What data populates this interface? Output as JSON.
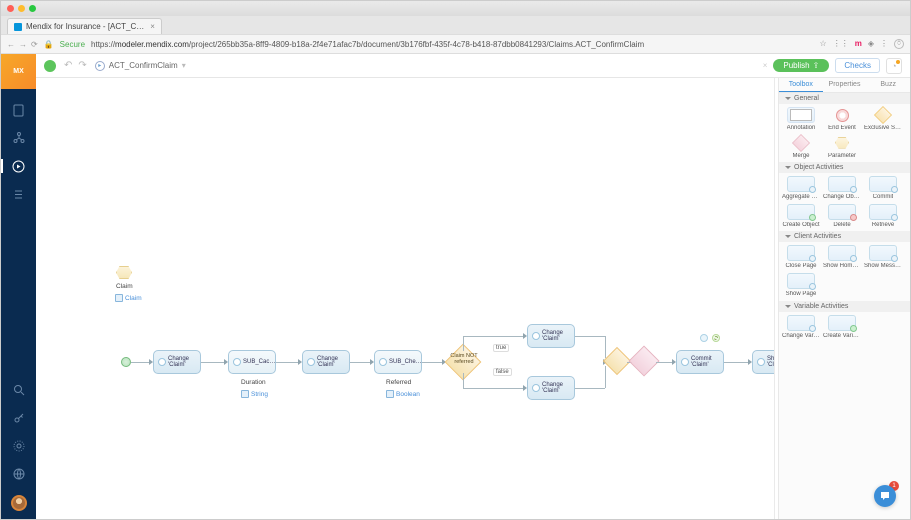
{
  "browser": {
    "tab_title": "Mendix for Insurance - [ACT_C…",
    "secure_label": "Secure",
    "url_host": "modeler.mendix.com",
    "url_path": "/project/265bb35a-8ff9-4809-b18a-2f4e71afac7b/document/3b176fbf-435f-4c78-b418-87dbb0841293/Claims.ACT_ConfirmClaim",
    "star": "☆",
    "ext_m": "m"
  },
  "topbar": {
    "doc_name": "ACT_ConfirmClaim",
    "publish": "Publish",
    "checks": "Checks"
  },
  "panel": {
    "tabs": {
      "toolbox": "Toolbox",
      "properties": "Properties",
      "buzz": "Buzz"
    },
    "cats": {
      "general": "General",
      "object": "Object Activities",
      "client": "Client Activities",
      "variable": "Variable Activities"
    },
    "tools": {
      "annotation": "Annotation",
      "end_event": "End Event",
      "exclusive_split": "Exclusive Split",
      "merge": "Merge",
      "parameter": "Parameter",
      "aggregate_list": "Aggregate List",
      "change_object": "Change Object",
      "commit": "Commit",
      "create_object": "Create Object",
      "delete": "Delete",
      "retrieve": "Retrieve",
      "close_page": "Close Page",
      "show_home_page": "Show Home P…",
      "show_message": "Show Message",
      "show_page": "Show Page",
      "change_variable": "Change Variable",
      "create_variable": "Create Variable"
    }
  },
  "flow": {
    "param_label": "Claim",
    "param_type": "Claim",
    "change1": "Change 'Claim'",
    "sub1": "SUB_Cac…",
    "sub1_out_label": "Duration",
    "sub1_out_type": "String",
    "change2": "Change 'Claim'",
    "sub2": "SUB_Che…",
    "sub2_out_label": "Referred",
    "sub2_out_type": "Boolean",
    "split_text": "Claim NOT referred",
    "edge_true": "true",
    "edge_false": "false",
    "change_top": "Change 'Claim'",
    "change_bot": "Change 'Claim'",
    "commit": "Commit 'Claim'",
    "show": "Show 'Claim_St…"
  },
  "chat_badge": "1"
}
